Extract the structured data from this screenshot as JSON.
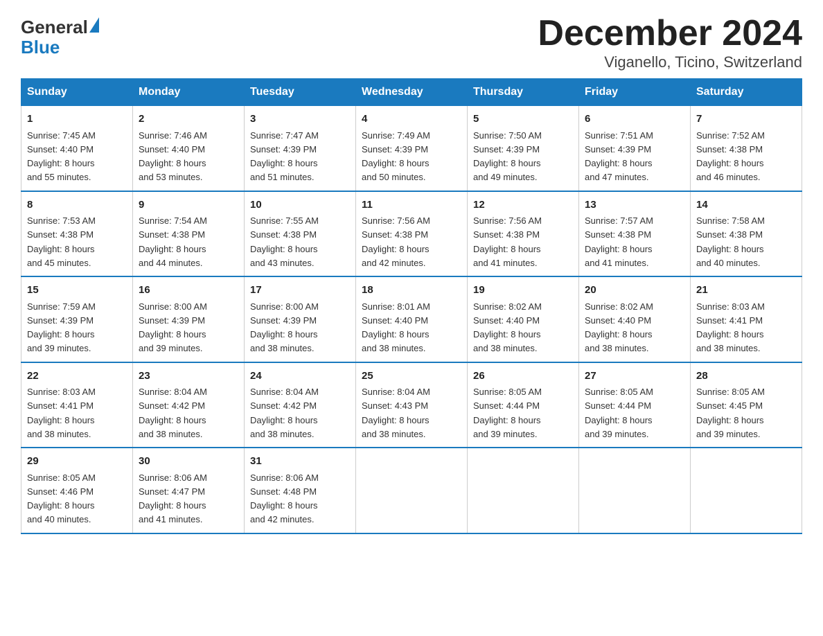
{
  "logo": {
    "text_general": "General",
    "text_blue": "Blue"
  },
  "title": "December 2024",
  "subtitle": "Viganello, Ticino, Switzerland",
  "days_of_week": [
    "Sunday",
    "Monday",
    "Tuesday",
    "Wednesday",
    "Thursday",
    "Friday",
    "Saturday"
  ],
  "weeks": [
    [
      {
        "day": "1",
        "sunrise": "7:45 AM",
        "sunset": "4:40 PM",
        "daylight": "8 hours and 55 minutes."
      },
      {
        "day": "2",
        "sunrise": "7:46 AM",
        "sunset": "4:40 PM",
        "daylight": "8 hours and 53 minutes."
      },
      {
        "day": "3",
        "sunrise": "7:47 AM",
        "sunset": "4:39 PM",
        "daylight": "8 hours and 51 minutes."
      },
      {
        "day": "4",
        "sunrise": "7:49 AM",
        "sunset": "4:39 PM",
        "daylight": "8 hours and 50 minutes."
      },
      {
        "day": "5",
        "sunrise": "7:50 AM",
        "sunset": "4:39 PM",
        "daylight": "8 hours and 49 minutes."
      },
      {
        "day": "6",
        "sunrise": "7:51 AM",
        "sunset": "4:39 PM",
        "daylight": "8 hours and 47 minutes."
      },
      {
        "day": "7",
        "sunrise": "7:52 AM",
        "sunset": "4:38 PM",
        "daylight": "8 hours and 46 minutes."
      }
    ],
    [
      {
        "day": "8",
        "sunrise": "7:53 AM",
        "sunset": "4:38 PM",
        "daylight": "8 hours and 45 minutes."
      },
      {
        "day": "9",
        "sunrise": "7:54 AM",
        "sunset": "4:38 PM",
        "daylight": "8 hours and 44 minutes."
      },
      {
        "day": "10",
        "sunrise": "7:55 AM",
        "sunset": "4:38 PM",
        "daylight": "8 hours and 43 minutes."
      },
      {
        "day": "11",
        "sunrise": "7:56 AM",
        "sunset": "4:38 PM",
        "daylight": "8 hours and 42 minutes."
      },
      {
        "day": "12",
        "sunrise": "7:56 AM",
        "sunset": "4:38 PM",
        "daylight": "8 hours and 41 minutes."
      },
      {
        "day": "13",
        "sunrise": "7:57 AM",
        "sunset": "4:38 PM",
        "daylight": "8 hours and 41 minutes."
      },
      {
        "day": "14",
        "sunrise": "7:58 AM",
        "sunset": "4:38 PM",
        "daylight": "8 hours and 40 minutes."
      }
    ],
    [
      {
        "day": "15",
        "sunrise": "7:59 AM",
        "sunset": "4:39 PM",
        "daylight": "8 hours and 39 minutes."
      },
      {
        "day": "16",
        "sunrise": "8:00 AM",
        "sunset": "4:39 PM",
        "daylight": "8 hours and 39 minutes."
      },
      {
        "day": "17",
        "sunrise": "8:00 AM",
        "sunset": "4:39 PM",
        "daylight": "8 hours and 38 minutes."
      },
      {
        "day": "18",
        "sunrise": "8:01 AM",
        "sunset": "4:40 PM",
        "daylight": "8 hours and 38 minutes."
      },
      {
        "day": "19",
        "sunrise": "8:02 AM",
        "sunset": "4:40 PM",
        "daylight": "8 hours and 38 minutes."
      },
      {
        "day": "20",
        "sunrise": "8:02 AM",
        "sunset": "4:40 PM",
        "daylight": "8 hours and 38 minutes."
      },
      {
        "day": "21",
        "sunrise": "8:03 AM",
        "sunset": "4:41 PM",
        "daylight": "8 hours and 38 minutes."
      }
    ],
    [
      {
        "day": "22",
        "sunrise": "8:03 AM",
        "sunset": "4:41 PM",
        "daylight": "8 hours and 38 minutes."
      },
      {
        "day": "23",
        "sunrise": "8:04 AM",
        "sunset": "4:42 PM",
        "daylight": "8 hours and 38 minutes."
      },
      {
        "day": "24",
        "sunrise": "8:04 AM",
        "sunset": "4:42 PM",
        "daylight": "8 hours and 38 minutes."
      },
      {
        "day": "25",
        "sunrise": "8:04 AM",
        "sunset": "4:43 PM",
        "daylight": "8 hours and 38 minutes."
      },
      {
        "day": "26",
        "sunrise": "8:05 AM",
        "sunset": "4:44 PM",
        "daylight": "8 hours and 39 minutes."
      },
      {
        "day": "27",
        "sunrise": "8:05 AM",
        "sunset": "4:44 PM",
        "daylight": "8 hours and 39 minutes."
      },
      {
        "day": "28",
        "sunrise": "8:05 AM",
        "sunset": "4:45 PM",
        "daylight": "8 hours and 39 minutes."
      }
    ],
    [
      {
        "day": "29",
        "sunrise": "8:05 AM",
        "sunset": "4:46 PM",
        "daylight": "8 hours and 40 minutes."
      },
      {
        "day": "30",
        "sunrise": "8:06 AM",
        "sunset": "4:47 PM",
        "daylight": "8 hours and 41 minutes."
      },
      {
        "day": "31",
        "sunrise": "8:06 AM",
        "sunset": "4:48 PM",
        "daylight": "8 hours and 42 minutes."
      },
      null,
      null,
      null,
      null
    ]
  ],
  "labels": {
    "sunrise": "Sunrise:",
    "sunset": "Sunset:",
    "daylight": "Daylight:"
  }
}
